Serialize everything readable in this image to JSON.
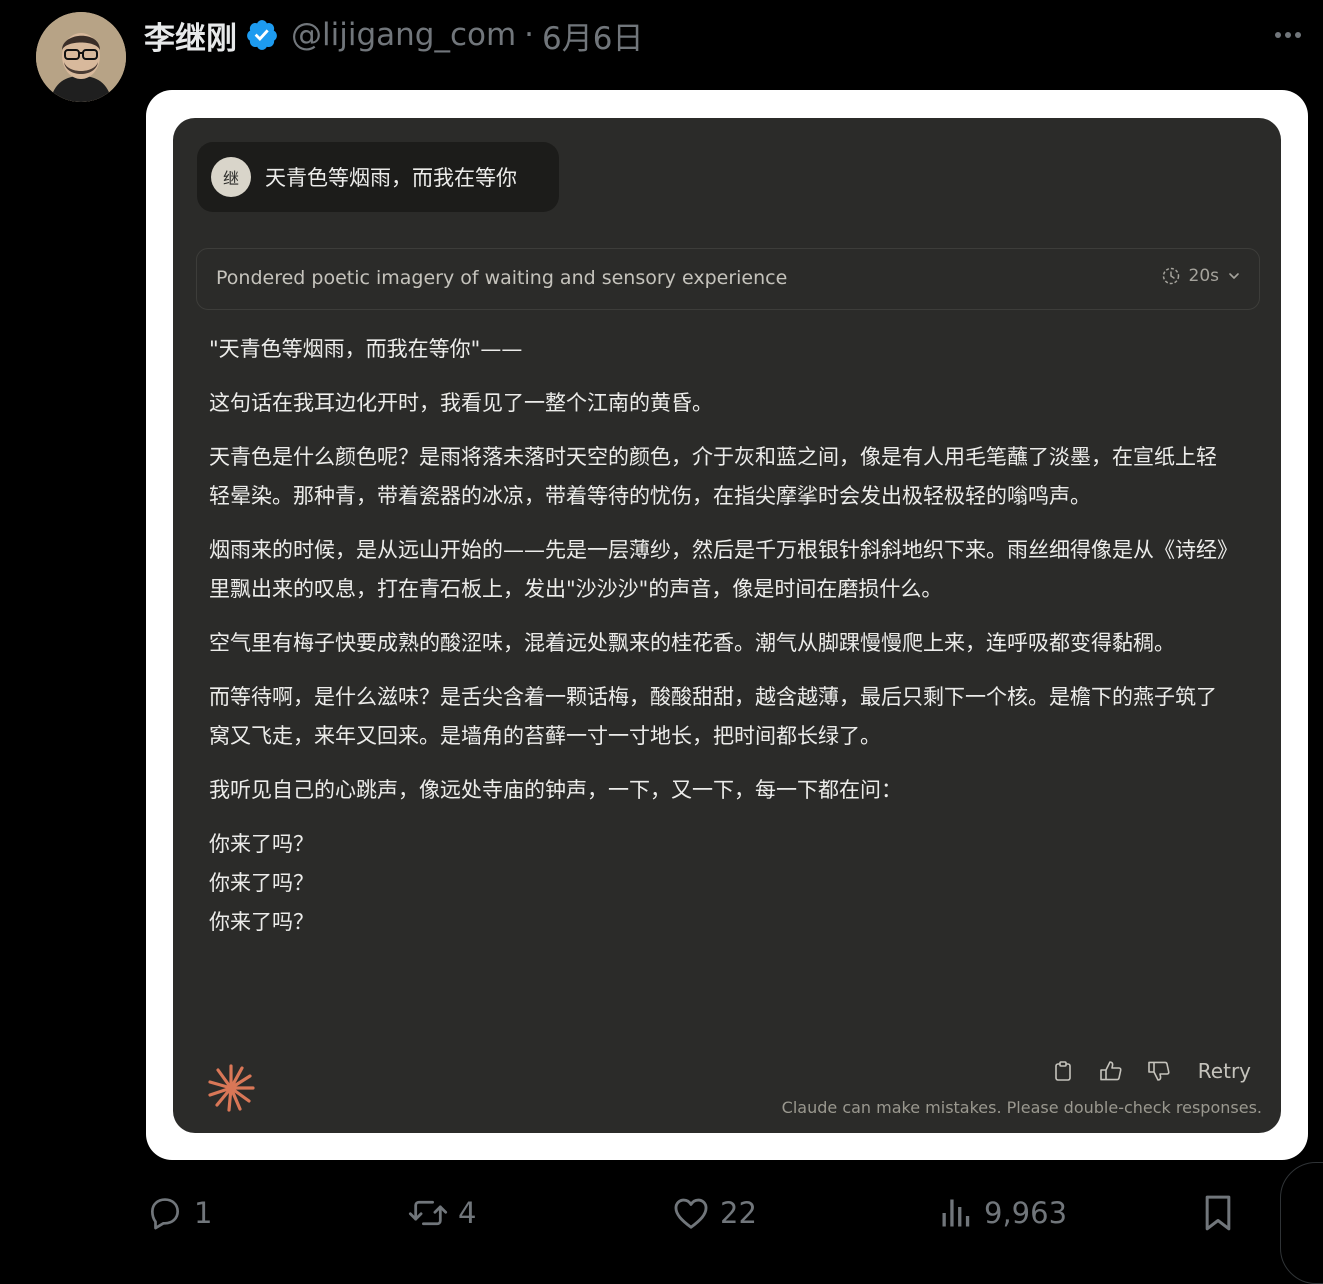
{
  "tweet": {
    "author_name": "李继刚",
    "handle": "@lijigang_com",
    "separator": "·",
    "date": "6月6日"
  },
  "chat": {
    "user_avatar_initial": "继",
    "user_message": "天青色等烟雨，而我在等你",
    "thinking_summary": "Pondered poetic imagery of waiting and sensory experience",
    "thinking_duration": "20s",
    "response_paragraphs": [
      "\"天青色等烟雨，而我在等你\"——",
      "这句话在我耳边化开时，我看见了一整个江南的黄昏。",
      "天青色是什么颜色呢？是雨将落未落时天空的颜色，介于灰和蓝之间，像是有人用毛笔蘸了淡墨，在宣纸上轻轻晕染。那种青，带着瓷器的冰凉，带着等待的忧伤，在指尖摩挲时会发出极轻极轻的嗡鸣声。",
      "烟雨来的时候，是从远山开始的——先是一层薄纱，然后是千万根银针斜斜地织下来。雨丝细得像是从《诗经》里飘出来的叹息，打在青石板上，发出\"沙沙沙\"的声音，像是时间在磨损什么。",
      "空气里有梅子快要成熟的酸涩味，混着远处飘来的桂花香。潮气从脚踝慢慢爬上来，连呼吸都变得黏稠。",
      "而等待啊，是什么滋味？是舌尖含着一颗话梅，酸酸甜甜，越含越薄，最后只剩下一个核。是檐下的燕子筑了窝又飞走，来年又回来。是墙角的苔藓一寸一寸地长，把时间都长绿了。",
      "我听见自己的心跳声，像远处寺庙的钟声，一下，又一下，每一下都在问："
    ],
    "poem_lines": [
      "你来了吗？",
      "你来了吗？",
      "你来了吗？"
    ],
    "retry_label": "Retry",
    "disclaimer": "Claude can make mistakes. Please double-check responses."
  },
  "engagement": {
    "replies": "1",
    "reposts": "4",
    "likes": "22",
    "views": "9,963"
  },
  "icons": {
    "verified": "verified-badge-icon",
    "more": "more-icon",
    "clock": "clock-icon",
    "chevron": "chevron-down-icon",
    "copy": "copy-icon",
    "thumbs_up": "thumbs-up-icon",
    "thumbs_down": "thumbs-down-icon",
    "claude_logo": "claude-logo-icon",
    "reply": "reply-icon",
    "repost": "repost-icon",
    "like": "like-icon",
    "views": "views-icon",
    "bookmark": "bookmark-icon"
  },
  "colors": {
    "page_bg": "#000000",
    "chat_bg": "#2b2b29",
    "verified_blue": "#1d9bf0",
    "claude_orange": "#d97757",
    "muted": "#71767b"
  }
}
